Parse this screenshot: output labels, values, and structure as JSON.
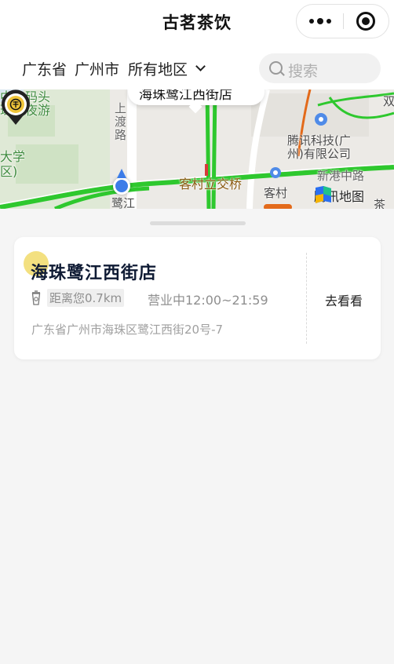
{
  "header": {
    "title": "古茗茶饮",
    "more_icon": "more-dots-icon",
    "target_icon": "target-icon"
  },
  "filter": {
    "province": "广东省",
    "city": "广州市",
    "district": "所有地区",
    "search_placeholder": "搜索"
  },
  "map": {
    "labels": {
      "campus_top": "中大码头",
      "campus_night": "珠江夜游",
      "campus_uni": "大学",
      "campus_district": "区)",
      "road_shangdu": "上\n渡\n路",
      "tencent_tech_1": "腾讯科技(广",
      "tencent_tech_2": "州)有限公司",
      "xingang": "新港中路",
      "kecun_interchange": "客村立交桥",
      "kecun": "客村",
      "lujiang": "鹭江",
      "tea_text": "茶",
      "shuang": "双"
    },
    "bubble_text": "海珠鹭江西街店",
    "provider": "腾讯地图",
    "colors": {
      "road_green": "#2ec82e",
      "road_orange": "#e36a1a",
      "location_blue": "#3c7ce8"
    }
  },
  "store": {
    "name": "海珠鹭江西街店",
    "distance": "距离您0.7km",
    "hours": "营业中12:00~21:59",
    "address": "广东省广州市海珠区鹭江西街20号-7",
    "action": "去看看"
  }
}
